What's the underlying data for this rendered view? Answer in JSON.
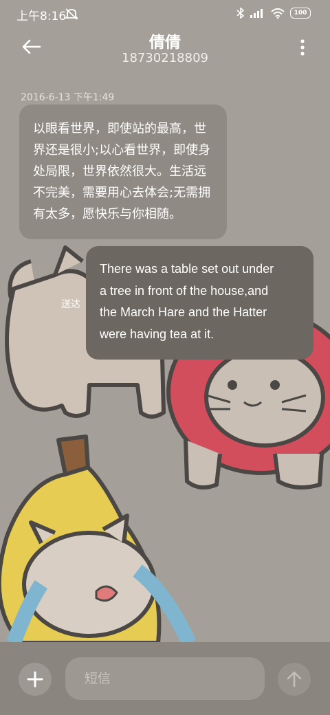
{
  "status_bar": {
    "time": "上午8:16",
    "battery": "100",
    "icons": [
      "mute-icon",
      "bluetooth-icon",
      "signal-icon",
      "wifi-icon",
      "battery-icon"
    ]
  },
  "header": {
    "contact_name": "倩倩",
    "phone_number": "18730218809",
    "back_icon": "back-arrow-icon",
    "menu_icon": "more-vertical-icon"
  },
  "conversation": {
    "timestamp": "2016-6-13 下午1:49",
    "incoming": {
      "lines": [
        "以眼看世界，即使站的最高，世",
        "界还是很小;以心看世界，即使身",
        "处局限，世界依然很大。生活远",
        "不完美，需要用心去体会;无需拥",
        "有太多，愿快乐与你相随。"
      ]
    },
    "outgoing": {
      "status": "送达",
      "lines": [
        "There was a table set out under",
        "a tree in front of the house,and",
        "the March Hare and the Hatter",
        "were having tea at it."
      ]
    }
  },
  "composer": {
    "placeholder": "短信",
    "add_icon": "plus-icon",
    "send_icon": "send-arrow-icon"
  },
  "colors": {
    "background": "#a49f98",
    "incoming_bubble": "#8f8a83",
    "outgoing_bubble": "#6c6760",
    "composer_bar": "#8a857e"
  }
}
